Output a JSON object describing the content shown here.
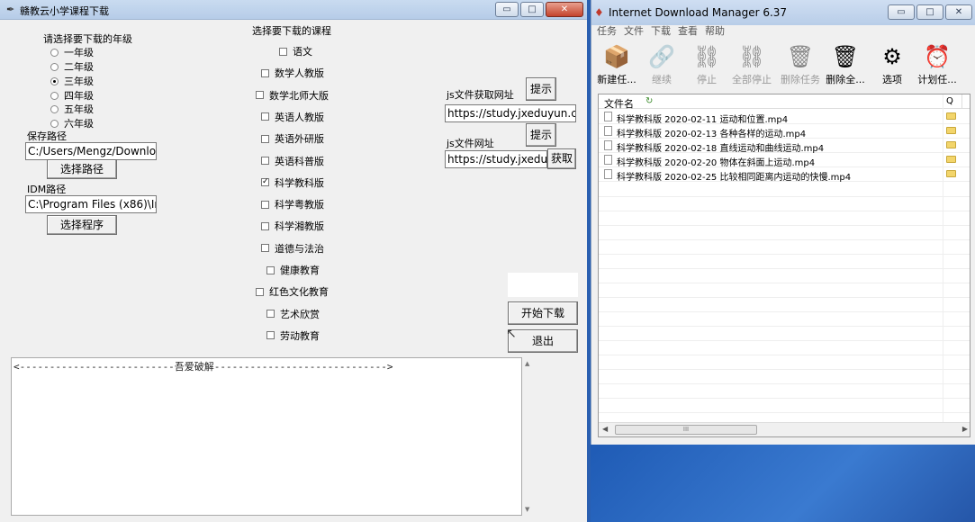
{
  "app": {
    "title": "赣教云小学课程下载",
    "win": {
      "min": "▭",
      "max": "□",
      "close": "✕"
    }
  },
  "grade": {
    "prompt": "请选择要下载的年级",
    "options": [
      "一年级",
      "二年级",
      "三年级",
      "四年级",
      "五年级",
      "六年级"
    ],
    "selected_index": 2
  },
  "save": {
    "label": "保存路径",
    "value": "C:/Users/Mengz/Downloa",
    "button": "选择路径"
  },
  "idm_path": {
    "label": "IDM路径",
    "value": "C:\\Program Files (x86)\\Int",
    "button": "选择程序"
  },
  "courses": {
    "prompt": "选择要下载的课程",
    "items": [
      {
        "label": "语文",
        "checked": false
      },
      {
        "label": "数学人教版",
        "checked": false
      },
      {
        "label": "数学北师大版",
        "checked": false
      },
      {
        "label": "英语人教版",
        "checked": false
      },
      {
        "label": "英语外研版",
        "checked": false
      },
      {
        "label": "英语科普版",
        "checked": false
      },
      {
        "label": "科学教科版",
        "checked": true
      },
      {
        "label": "科学粤教版",
        "checked": false
      },
      {
        "label": "科学湘教版",
        "checked": false
      },
      {
        "label": "道德与法治",
        "checked": false
      },
      {
        "label": "健康教育",
        "checked": false
      },
      {
        "label": "红色文化教育",
        "checked": false
      },
      {
        "label": "艺术欣赏",
        "checked": false
      },
      {
        "label": "劳动教育",
        "checked": false
      }
    ]
  },
  "js": {
    "fetch_label": "js文件获取网址",
    "fetch_value": "https://study.jxeduyun.cc",
    "hint1": "提示",
    "url_label": "js文件网址",
    "url_value": "https://study.jxeduy",
    "hint2": "提示",
    "get_button": "获取"
  },
  "actions": {
    "start": "开始下载",
    "exit": "退出"
  },
  "log": {
    "text": "<--------------------------吾爱破解----------------------------->"
  },
  "idm": {
    "title": "Internet Download Manager 6.37",
    "menu": [
      "任务",
      "文件",
      "下载",
      "查看",
      "帮助"
    ],
    "toolbar": [
      {
        "label": "新建任...",
        "icon": "📦",
        "enabled": true
      },
      {
        "label": "继续",
        "icon": "🔗",
        "enabled": false
      },
      {
        "label": "停止",
        "icon": "⛓",
        "enabled": false
      },
      {
        "label": "全部停止",
        "icon": "⛓",
        "enabled": false
      },
      {
        "label": "删除任务",
        "icon": "🗑",
        "enabled": false
      },
      {
        "label": "删除全...",
        "icon": "🗑",
        "enabled": true
      },
      {
        "label": "选项",
        "icon": "⚙",
        "enabled": true
      },
      {
        "label": "计划任...",
        "icon": "⏰",
        "enabled": true
      }
    ],
    "list_header": {
      "name": "文件名",
      "q": "Q"
    },
    "files": [
      "科学教科版 2020-02-11 运动和位置.mp4",
      "科学教科版 2020-02-13 各种各样的运动.mp4",
      "科学教科版 2020-02-18 直线运动和曲线运动.mp4",
      "科学教科版 2020-02-20 物体在斜面上运动.mp4",
      "科学教科版 2020-02-25 比较相同距离内运动的快慢.mp4"
    ],
    "scroll_thumb": "III"
  }
}
